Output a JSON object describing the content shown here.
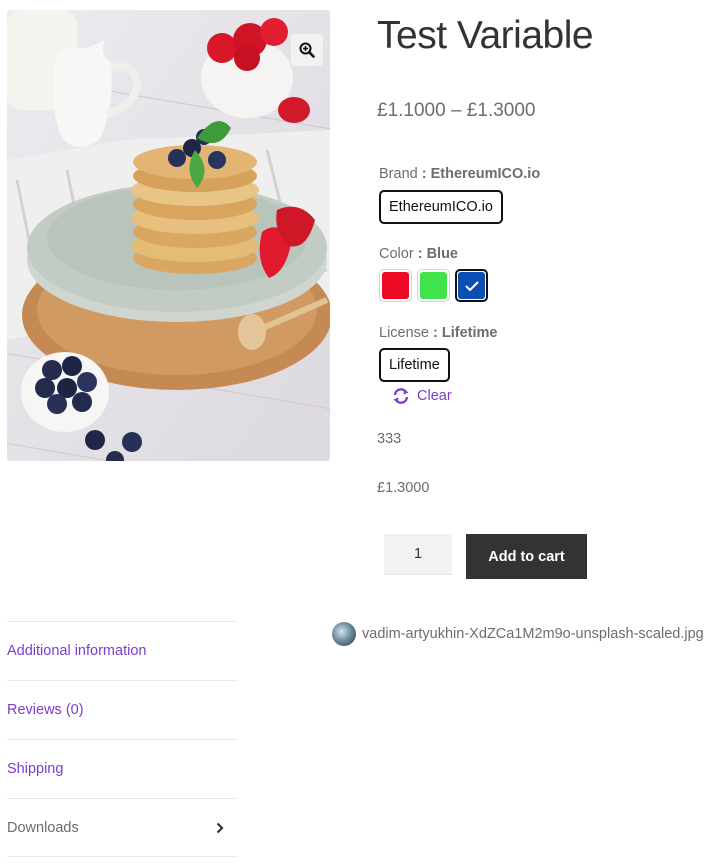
{
  "product": {
    "title": "Test Variable",
    "price_range": "£1.1000 – £1.3000",
    "image_alt": "pancakes with strawberries and blueberries"
  },
  "attributes": {
    "brand": {
      "label": "Brand",
      "sep": ":",
      "selected": "EthereumICO.io",
      "option": "EthereumICO.io"
    },
    "color": {
      "label": "Color",
      "sep": ":",
      "selected": "Blue",
      "options": [
        {
          "name": "Red",
          "hex": "#ee0a24"
        },
        {
          "name": "Green",
          "hex": "#41e34a"
        },
        {
          "name": "Blue",
          "hex": "#0b4fb5"
        }
      ]
    },
    "license": {
      "label": "License",
      "sep": ":",
      "selected": "Lifetime",
      "option": "Lifetime"
    },
    "clear_label": "Clear"
  },
  "variation": {
    "stock": "333",
    "price": "£1.3000"
  },
  "cart": {
    "quantity": "1",
    "add_label": "Add to cart"
  },
  "tabs": [
    {
      "label": "Additional information"
    },
    {
      "label": "Reviews (0)"
    },
    {
      "label": "Shipping"
    },
    {
      "label": "Downloads",
      "active": true
    }
  ],
  "downloads": {
    "file_name": "vadim-artyukhin-XdZCa1M2m9o-unsplash-scaled.jpg"
  },
  "colors": {
    "accent": "#7c3ecd",
    "button_bg": "#333333",
    "text": "#6d6d6d"
  },
  "icons": {
    "zoom": "zoom-in-icon",
    "clear": "refresh-icon",
    "check": "check-icon",
    "chevron": "chevron-right-icon"
  }
}
